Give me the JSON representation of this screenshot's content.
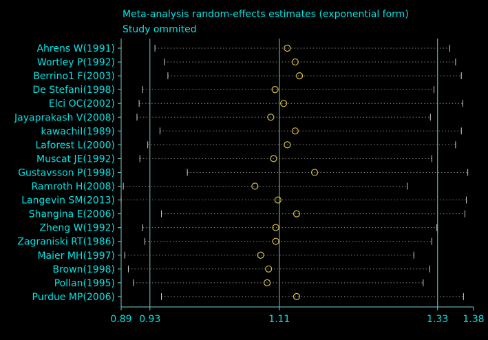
{
  "colors": {
    "background": "#000000",
    "text": "#00e5e5",
    "axis": "#6fd0d0",
    "ci_dots": "#8a8a8a",
    "ci_caps": "#cfcfcf",
    "estimate_marker": "#d9c04a"
  },
  "chart_data": {
    "type": "forest",
    "title_lines": [
      "Meta-analysis random-effects estimates (exponential form)",
      "Study ommited"
    ],
    "xlabel": "",
    "ylabel": "",
    "x_ticks": [
      0.89,
      0.93,
      1.11,
      1.33,
      1.38
    ],
    "x_tick_labels": [
      "0.89",
      "0.93",
      "1.11",
      "1.33",
      "1.38"
    ],
    "reference_lines": [
      0.93,
      1.11,
      1.33
    ],
    "xlim": [
      0.89,
      1.38
    ],
    "grid": false,
    "legend": "none",
    "studies": [
      {
        "label": "Ahrens W(1991)",
        "estimate": 1.121,
        "lower": 0.937,
        "upper": 1.347
      },
      {
        "label": "Wortley P(1992)",
        "estimate": 1.132,
        "lower": 0.95,
        "upper": 1.355
      },
      {
        "label": "Berrino1 F(2003)",
        "estimate": 1.138,
        "lower": 0.955,
        "upper": 1.363
      },
      {
        "label": "De Stefani(1998)",
        "estimate": 1.104,
        "lower": 0.92,
        "upper": 1.325
      },
      {
        "label": "Elci OC(2002)",
        "estimate": 1.116,
        "lower": 0.915,
        "upper": 1.365
      },
      {
        "label": "Jayaprakash V(2008)",
        "estimate": 1.098,
        "lower": 0.912,
        "upper": 1.32
      },
      {
        "label": "kawachiI(1989)",
        "estimate": 1.132,
        "lower": 0.944,
        "upper": 1.363
      },
      {
        "label": "Laforest L(2000)",
        "estimate": 1.121,
        "lower": 0.927,
        "upper": 1.355
      },
      {
        "label": "Muscat JE(1992)",
        "estimate": 1.102,
        "lower": 0.916,
        "upper": 1.322
      },
      {
        "label": "Gustavsson P(1998)",
        "estimate": 1.159,
        "lower": 0.982,
        "upper": 1.372
      },
      {
        "label": "Ramroth H(2008)",
        "estimate": 1.076,
        "lower": 0.893,
        "upper": 1.288
      },
      {
        "label": "Langevin SM(2013)",
        "estimate": 1.108,
        "lower": 0.89,
        "upper": 1.37
      },
      {
        "label": "Shangina E(2006)",
        "estimate": 1.134,
        "lower": 0.946,
        "upper": 1.368
      },
      {
        "label": "Zheng W(1992)",
        "estimate": 1.105,
        "lower": 0.92,
        "upper": 1.329
      },
      {
        "label": "Zagraniski RT(1986)",
        "estimate": 1.105,
        "lower": 0.923,
        "upper": 1.322
      },
      {
        "label": "Maier MH(1997)",
        "estimate": 1.084,
        "lower": 0.895,
        "upper": 1.297
      },
      {
        "label": "Brown(1998)",
        "estimate": 1.095,
        "lower": 0.9,
        "upper": 1.319
      },
      {
        "label": "Pollan(1995)",
        "estimate": 1.093,
        "lower": 0.907,
        "upper": 1.31
      },
      {
        "label": "Purdue MP(2006)",
        "estimate": 1.134,
        "lower": 0.946,
        "upper": 1.366
      }
    ]
  }
}
